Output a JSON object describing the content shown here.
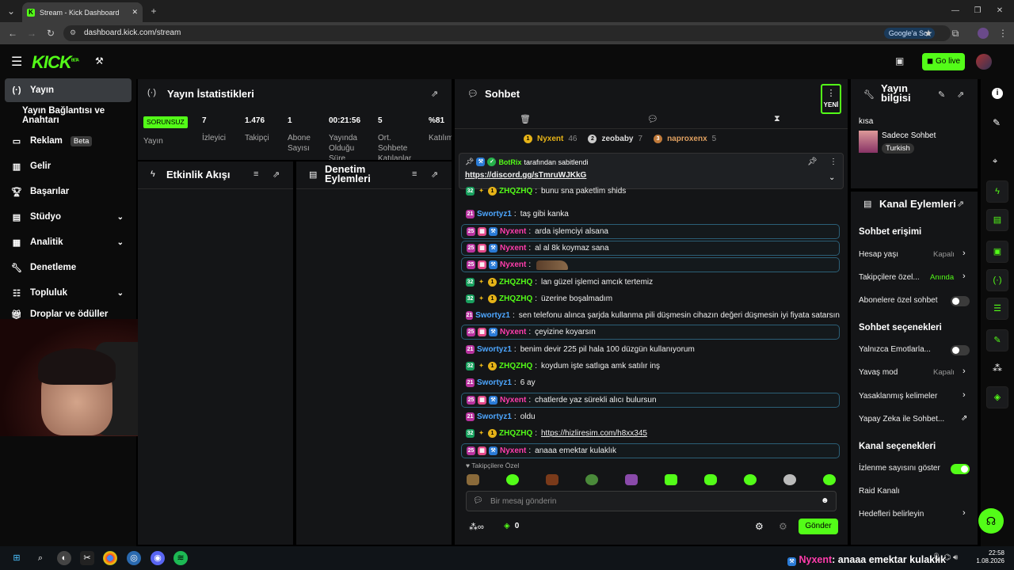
{
  "browser": {
    "tab_title": "Stream - Kick Dashboard",
    "url": "dashboard.kick.com/stream",
    "google_chip": "Google'a Sor"
  },
  "header": {
    "logo": "KICK",
    "logo_sup": "BETA",
    "go_live": "Go live"
  },
  "sidebar": {
    "items": [
      {
        "label": "Yayın",
        "icon": "broadcast-icon",
        "active": true
      },
      {
        "label": "Yayın Bağlantısı ve Anahtarı",
        "icon": ""
      },
      {
        "label": "Reklam",
        "badge": "Beta",
        "icon": "ad-icon"
      },
      {
        "label": "Gelir",
        "icon": "chart-icon"
      },
      {
        "label": "Başarılar",
        "icon": "trophy-icon"
      },
      {
        "label": "Stüdyo",
        "icon": "studio-icon"
      },
      {
        "label": "Analitik",
        "icon": "analytics-icon"
      },
      {
        "label": "Denetleme",
        "icon": "wrench-icon"
      },
      {
        "label": "Topluluk",
        "icon": "community-icon"
      },
      {
        "label": "Droplar ve ödüller",
        "icon": "gift-icon"
      }
    ]
  },
  "stats": {
    "title": "Yayın İstatistikleri",
    "status": "SORUNSUZ",
    "status_label": "Yayın",
    "items": [
      {
        "value": "7",
        "label": "İzleyici"
      },
      {
        "value": "1.476",
        "label": "Takipçi"
      },
      {
        "value": "1",
        "label": "Abone Sayısı"
      },
      {
        "value": "00:21:56",
        "label": "Yayında Olduğu Süre"
      },
      {
        "value": "5",
        "label": "Ort. Sohbete Katılanlar"
      },
      {
        "value": "%81",
        "label": "Katılım"
      }
    ]
  },
  "activity": {
    "title": "Etkinlik Akışı"
  },
  "moderation": {
    "title": "Denetim Eylemleri"
  },
  "chat": {
    "title": "Sohbet",
    "new_label": "YENİ",
    "top_chatters": [
      {
        "name": "Nyxent",
        "count": "46"
      },
      {
        "name": "zeobaby",
        "count": "7"
      },
      {
        "name": "naproxenx",
        "count": "5"
      }
    ],
    "pinned": {
      "by": "BotRix",
      "by_suffix": "tarafından sabitlendi",
      "link": "https://discord.gg/sTmruWJKkG"
    },
    "messages": [
      {
        "user": "ZHQZHQ",
        "text": "bunu sna paketlim shids",
        "type": "zhq"
      },
      {
        "user": "Swortyz1",
        "text": "taş gibi kanka",
        "type": "swo"
      },
      {
        "user": "Nyxent",
        "text": "arda işlemciyi alsana",
        "type": "nyx"
      },
      {
        "user": "Nyxent",
        "text": "al al 8k koymaz sana",
        "type": "nyx"
      },
      {
        "user": "Nyxent",
        "text": "",
        "type": "nyx",
        "emote": true
      },
      {
        "user": "ZHQZHQ",
        "text": "lan güzel işlemci amcık tertemiz",
        "type": "zhq"
      },
      {
        "user": "ZHQZHQ",
        "text": "üzerine boşalmadım",
        "type": "zhq"
      },
      {
        "user": "Swortyz1",
        "text": "sen telefonu alınca şarjda kullanma pili düşmesin cihazın değeri düşmesin iyi fiyata satarsın",
        "type": "swo"
      },
      {
        "user": "Nyxent",
        "text": "çeyizine koyarsın",
        "type": "nyx"
      },
      {
        "user": "Swortyz1",
        "text": "benim devir 225 pil hala 100 düzgün kullanıyorum",
        "type": "swo"
      },
      {
        "user": "ZHQZHQ",
        "text": "koydum işte satlıga amk satılır inş",
        "type": "zhq"
      },
      {
        "user": "Swortyz1",
        "text": "6 ay",
        "type": "swo"
      },
      {
        "user": "Nyxent",
        "text": "chatlerde yaz sürekli alıcı bulursun",
        "type": "nyx"
      },
      {
        "user": "Swortyz1",
        "text": "oldu",
        "type": "swo"
      },
      {
        "user": "ZHQZHQ",
        "text": "https://hizliresim.com/h8xx345",
        "type": "zhq",
        "link": true
      },
      {
        "user": "Nyxent",
        "text": "anaaa emektar kulaklık",
        "type": "nyx"
      }
    ],
    "follower_emotes_label": "Takipçilere Özel",
    "input_placeholder": "Bir mesaj gönderin",
    "points": "0",
    "send": "Gönder"
  },
  "stream_info": {
    "title": "Yayın bilgisi",
    "label": "kısa",
    "category": "Sadece Sohbet",
    "tag": "Turkish"
  },
  "channel_actions": {
    "title": "Kanal Eylemleri",
    "chat_access": "Sohbet erişimi",
    "account_age": {
      "label": "Hesap yaşı",
      "value": "Kapalı"
    },
    "followers_only": {
      "label": "Takipçilere özel...",
      "value": "Anında"
    },
    "subs_only": {
      "label": "Abonelere özel sohbet",
      "on": false
    },
    "chat_options": "Sohbet seçenekleri",
    "emotes_only": {
      "label": "Yalnızca Emotlarla...",
      "on": false
    },
    "slow_mode": {
      "label": "Yavaş mod",
      "value": "Kapalı"
    },
    "banned_words": {
      "label": "Yasaklanmış kelimeler"
    },
    "ai_chat": {
      "label": "Yapay Zeka ile Sohbet..."
    },
    "channel_options": "Kanal seçenekleri",
    "show_views": {
      "label": "İzlenme sayısını göster",
      "on": true
    },
    "raid": {
      "label": "Raid Kanalı"
    },
    "goals": {
      "label": "Hedefleri belirleyin"
    }
  },
  "taskbar": {
    "ticker_user": "Nyxent",
    "ticker_msg": ": anaaa emektar kulaklık",
    "time": "22:58",
    "date": "1.08.2026"
  },
  "colors": {
    "accent": "#53fc18",
    "nyxent": "#ff3dac",
    "swortyz": "#4da6ff"
  }
}
